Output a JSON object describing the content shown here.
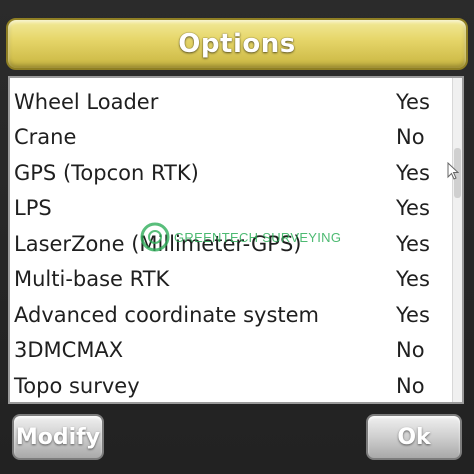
{
  "title": "Options",
  "options": [
    {
      "name": "Wheel Loader",
      "value": "Yes"
    },
    {
      "name": "Crane",
      "value": "No"
    },
    {
      "name": "GPS (Topcon RTK)",
      "value": "Yes"
    },
    {
      "name": "LPS",
      "value": "Yes"
    },
    {
      "name": "LaserZone (Millimeter-GPS)",
      "value": "Yes"
    },
    {
      "name": "Multi-base RTK",
      "value": "Yes"
    },
    {
      "name": "Advanced coordinate system",
      "value": "Yes"
    },
    {
      "name": "3DMCMAX",
      "value": "No"
    },
    {
      "name": "Topo survey",
      "value": "No"
    }
  ],
  "buttons": {
    "modify": "Modify",
    "ok": "Ok"
  },
  "watermark": "GREENTECH SURVEYING",
  "colors": {
    "title_bar": "#e6d66a",
    "list_background": "#ffffff",
    "text": "#1f1f1f",
    "watermark": "#2fae5a"
  }
}
